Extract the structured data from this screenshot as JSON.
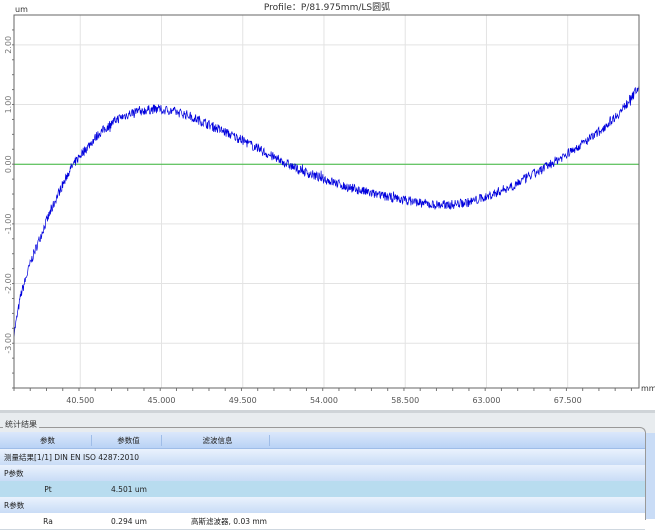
{
  "chart_data": {
    "type": "line",
    "title": "Profile：P/81.975mm/LS圆弧",
    "ylabel": "um",
    "xlabel": "mm",
    "xlim": [
      36.83,
      71.45
    ],
    "ylim": [
      -3.75,
      2.5
    ],
    "xticks": [
      "40.500",
      "45.000",
      "49.500",
      "54.000",
      "58.500",
      "63.000",
      "67.500"
    ],
    "xtick_values": [
      40.5,
      45,
      49.5,
      54,
      58.5,
      63,
      67.5
    ],
    "yticks": [
      "2.00",
      "1.00",
      "0.00",
      "-1.00",
      "-2.00",
      "-3.00"
    ],
    "ytick_values": [
      2,
      1,
      0,
      -1,
      -2,
      -3
    ],
    "grid": true,
    "reference_line": {
      "y": 0,
      "color": "#3cb83c"
    },
    "series": [
      {
        "color": "#0000dd",
        "x": [
          36.83,
          37.2,
          37.8,
          38.5,
          39.2,
          39.9,
          40.5,
          41.5,
          42.5,
          43.5,
          44.5,
          45.5,
          46.5,
          47.5,
          49.5,
          51,
          52.5,
          54,
          55.5,
          57,
          58.5,
          60,
          61,
          62,
          63,
          64.5,
          66,
          67.5,
          69,
          70.5,
          71.45
        ],
        "y": [
          -2.85,
          -2.2,
          -1.6,
          -1.05,
          -0.55,
          -0.1,
          0.15,
          0.5,
          0.75,
          0.88,
          0.92,
          0.9,
          0.82,
          0.68,
          0.4,
          0.15,
          -0.08,
          -0.25,
          -0.4,
          -0.52,
          -0.6,
          -0.68,
          -0.68,
          -0.64,
          -0.55,
          -0.35,
          -0.1,
          0.18,
          0.48,
          0.9,
          1.3
        ]
      }
    ]
  },
  "stats": {
    "group_title": "统计结果",
    "columns": [
      "参数",
      "参数值",
      "滤波信息"
    ],
    "measurement": "测量结果[1/1] DIN EN ISO 4287:2010",
    "p_section": "P参数",
    "r_section": "R参数",
    "rows": [
      {
        "param": "Pt",
        "value": "4.501 um",
        "filter": ""
      },
      {
        "param": "Ra",
        "value": "0.294 um",
        "filter": "高斯滤波器, 0.03 mm"
      }
    ]
  }
}
